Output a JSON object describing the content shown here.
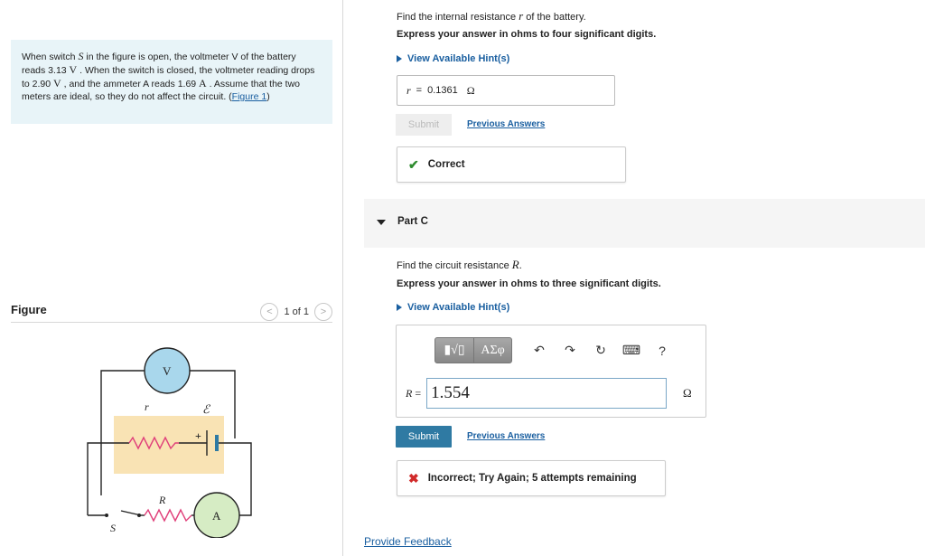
{
  "problem": {
    "text_part1": "When switch ",
    "switch_symbol": "S",
    "text_part2": " in the figure is open, the voltmeter V of the battery reads 3.13 ",
    "unit_v1": "V",
    "text_part3": " . When the switch is closed, the voltmeter reading drops to 2.90 ",
    "unit_v2": "V",
    "text_part4": " , and the ammeter A reads 1.69 ",
    "unit_a": "A",
    "text_part5": " . Assume that the two meters are ideal, so they do not affect the circuit. (",
    "figure_link": "Figure 1",
    "text_part6": ")"
  },
  "figure": {
    "title": "Figure",
    "pager": "1 of 1",
    "prev_glyph": "<",
    "next_glyph": ">",
    "labels": {
      "voltmeter": "V",
      "ammeter": "A",
      "internal_resistance": "r",
      "emf": "ℰ",
      "plus": "+",
      "resistor": "R",
      "switch": "S"
    }
  },
  "partB": {
    "prompt_pre": "Find the internal resistance ",
    "prompt_var": "r",
    "prompt_post": " of the battery.",
    "instruction": "Express your answer in ohms to four significant digits.",
    "hint_label": "View Available Hint(s)",
    "answer_var": "r",
    "answer_eq": "=",
    "answer_value": "0.1361",
    "answer_unit": "Ω",
    "submit_label": "Submit",
    "previous_answers_label": "Previous Answers",
    "feedback": "Correct"
  },
  "partC": {
    "label": "Part C",
    "prompt_pre": "Find the circuit resistance ",
    "prompt_var": "R",
    "prompt_post": ".",
    "instruction": "Express your answer in ohms to three significant digits.",
    "hint_label": "View Available Hint(s)",
    "toolbar": {
      "templates_glyph": "▮√▯",
      "greek_glyph": "ΑΣφ",
      "undo_glyph": "↶",
      "redo_glyph": "↷",
      "reset_glyph": "↻",
      "keyboard_glyph": "⌨",
      "help_glyph": "?"
    },
    "input_var": "R",
    "input_eq": "=",
    "input_value": "1.554",
    "input_unit": "Ω",
    "submit_label": "Submit",
    "previous_answers_label": "Previous Answers",
    "feedback": "Incorrect; Try Again; 5 attempts remaining"
  },
  "footer": {
    "provide_feedback": "Provide Feedback"
  },
  "colors": {
    "problem_bg": "#e8f4f8",
    "link": "#1a5fa0",
    "submit_bg": "#2f7aa3",
    "voltmeter_fill": "#a9d7ec",
    "ammeter_fill": "#d6ecc4",
    "battery_box": "#f9e3b4",
    "resistor_stroke": "#e0407a",
    "correct": "#2e8b2e",
    "incorrect": "#d12a2a"
  }
}
